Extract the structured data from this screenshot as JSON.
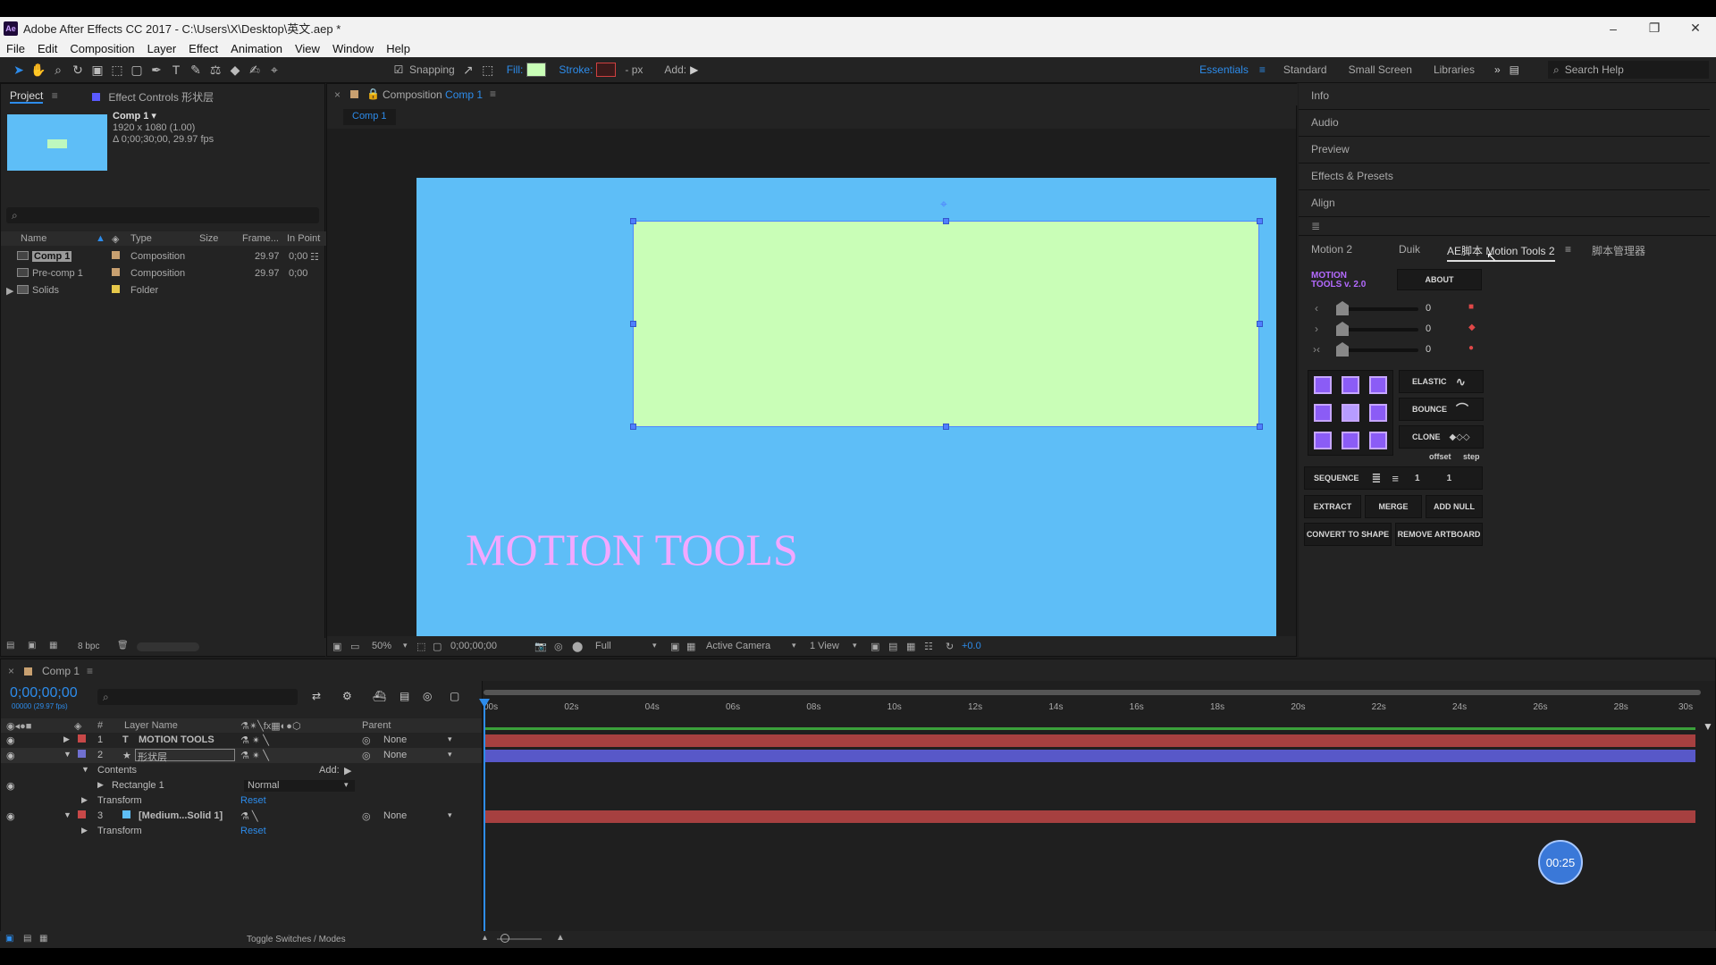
{
  "titlebar": {
    "title": "Adobe After Effects CC 2017 - C:\\Users\\X\\Desktop\\英文.aep *",
    "logo": "Ae"
  },
  "menu": [
    "File",
    "Edit",
    "Composition",
    "Layer",
    "Effect",
    "Animation",
    "View",
    "Window",
    "Help"
  ],
  "toolbar": {
    "snapping": "Snapping",
    "fill": "Fill:",
    "stroke": "Stroke:",
    "px": "- px",
    "add": "Add:",
    "fill_color": "#c9feb7",
    "stroke_color": "#d04040"
  },
  "workspaces": [
    "Essentials",
    "Standard",
    "Small Screen",
    "Libraries"
  ],
  "search_help": "Search Help",
  "project": {
    "tab": "Project",
    "effect_controls": "Effect Controls 形状层",
    "comp_name": "Comp 1 ▾",
    "comp_dims": "1920 x 1080 (1.00)",
    "comp_dur": "Δ 0;00;30;00, 29.97 fps",
    "headers": [
      "Name",
      "Type",
      "Size",
      "Frame...",
      "In Point"
    ],
    "items": [
      {
        "name": "Comp 1",
        "type": "Composition",
        "frame": "29.97",
        "in": "0;00",
        "color": "#c8a070"
      },
      {
        "name": "Pre-comp 1",
        "type": "Composition",
        "frame": "29.97",
        "in": "0;00",
        "color": "#c8a070"
      },
      {
        "name": "Solids",
        "type": "Folder",
        "frame": "",
        "in": "",
        "color": "#e6c84a"
      }
    ],
    "bpc": "8 bpc"
  },
  "composition": {
    "tab_prefix": "Composition",
    "tab_name": "Comp 1",
    "sub_tab": "Comp 1",
    "text": "MOTION TOOLS",
    "zoom": "50%",
    "timecode": "0;00;00;00",
    "quality": "Full",
    "camera": "Active Camera",
    "view": "1 View",
    "exposure": "+0.0"
  },
  "right_panels": [
    "Info",
    "Audio",
    "Preview",
    "Effects & Presets",
    "Align"
  ],
  "motion_tools": {
    "tabs": [
      "Motion 2",
      "Duik",
      "AE脚本 Motion Tools 2",
      "脚本管理器"
    ],
    "logo_line1": "MOTION",
    "logo_line2": "TOOLS v. 2.0",
    "about": "ABOUT",
    "sliders": [
      {
        "arrow": "‹",
        "value": "0",
        "mark": "■"
      },
      {
        "arrow": "›",
        "value": "0",
        "mark": "◆"
      },
      {
        "arrow": "›‹",
        "value": "0",
        "mark": "●"
      }
    ],
    "elastic": "ELASTIC",
    "bounce": "BOUNCE",
    "clone": "CLONE",
    "offset": "offset",
    "step": "step",
    "sequence": "SEQUENCE",
    "seq_offset": "1",
    "seq_step": "1",
    "extract": "EXTRACT",
    "merge": "MERGE",
    "add_null": "ADD NULL",
    "convert": "CONVERT TO SHAPE",
    "remove_artboard": "REMOVE ARTBOARD"
  },
  "timeline": {
    "tab": "Comp 1",
    "time": "0;00;00;00",
    "sub": "00000 (29.97 fps)",
    "headers": {
      "num": "#",
      "name": "Layer Name",
      "parent": "Parent"
    },
    "layers": [
      {
        "num": "1",
        "name": "MOTION TOOLS",
        "prefix": "T",
        "parent": "None",
        "color": "#c84848",
        "bar": "#a64040"
      },
      {
        "num": "2",
        "name": "形状层",
        "prefix": "★",
        "parent": "None",
        "color": "#7070d0",
        "bar": "#5858c8"
      },
      {
        "num": "3",
        "name": "[Medium...Solid 1]",
        "prefix": "",
        "parent": "None",
        "color": "#c84848",
        "bar": "#a64040"
      }
    ],
    "contents": "Contents",
    "add": "Add:",
    "rectangle": "Rectangle 1",
    "blend": "Normal",
    "transform": "Transform",
    "reset": "Reset",
    "ruler": [
      "00s",
      "02s",
      "04s",
      "06s",
      "08s",
      "10s",
      "12s",
      "14s",
      "16s",
      "18s",
      "20s",
      "22s",
      "24s",
      "26s",
      "28s",
      "30s"
    ],
    "toggle": "Toggle Switches / Modes",
    "badge": "00:25"
  }
}
